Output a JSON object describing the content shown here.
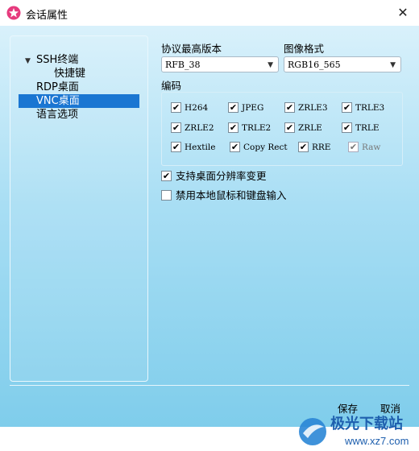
{
  "window": {
    "title": "会话属性",
    "close_glyph": "✕"
  },
  "tree": {
    "items": [
      {
        "label": "SSH终端",
        "expanded": true
      },
      {
        "label": "快捷键"
      },
      {
        "label": "RDP桌面"
      },
      {
        "label": "VNC桌面",
        "selected": true
      },
      {
        "label": "语言选项"
      }
    ]
  },
  "protocol": {
    "label": "协议最高版本",
    "value": "RFB_38"
  },
  "image_format": {
    "label": "图像格式",
    "value": "RGB16_565"
  },
  "encoding": {
    "label": "编码",
    "options": [
      {
        "label": "H264",
        "checked": true
      },
      {
        "label": "JPEG",
        "checked": true
      },
      {
        "label": "ZRLE3",
        "checked": true
      },
      {
        "label": "TRLE3",
        "checked": true
      },
      {
        "label": "ZRLE2",
        "checked": true
      },
      {
        "label": "TRLE2",
        "checked": true
      },
      {
        "label": "ZRLE",
        "checked": true
      },
      {
        "label": "TRLE",
        "checked": true
      },
      {
        "label": "Hextile",
        "checked": true
      },
      {
        "label": "Copy Rect",
        "checked": true
      },
      {
        "label": "RRE",
        "checked": true
      },
      {
        "label": "Raw",
        "checked": true,
        "disabled": true
      }
    ]
  },
  "options": {
    "desktop_resize": {
      "label": "支持桌面分辨率变更",
      "checked": true
    },
    "disable_input": {
      "label": "禁用本地鼠标和键盘输入",
      "checked": false
    }
  },
  "buttons": {
    "save": "保存",
    "cancel": "取消"
  },
  "watermark": {
    "text_cn": "极光下载站",
    "text_url": "www.xz7.com"
  },
  "colors": {
    "accent": "#1a76d2",
    "bg_top": "#d9f1fb",
    "bg_bottom": "#7fcdeb"
  },
  "icons": {
    "app": "star-flower-icon",
    "close": "close-icon",
    "dropdown": "chevron-down-icon",
    "expander": "triangle-down-icon"
  }
}
